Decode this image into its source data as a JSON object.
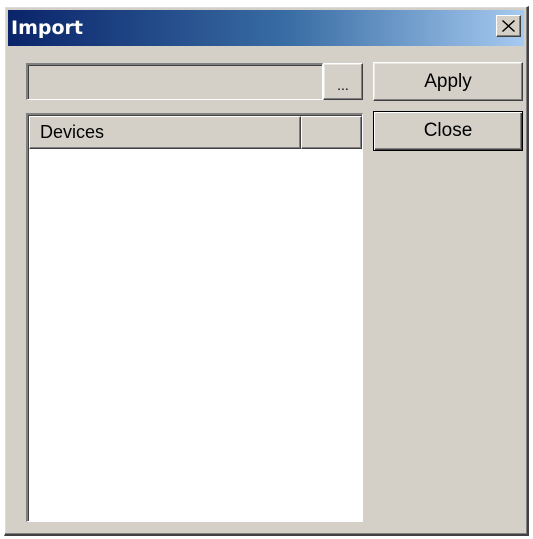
{
  "window": {
    "title": "Import",
    "close_glyph": "✕"
  },
  "path": {
    "value": "",
    "browse_label": "..."
  },
  "buttons": {
    "apply_label": "Apply",
    "close_label": "Close"
  },
  "list": {
    "columns": [
      "Devices",
      ""
    ],
    "rows": []
  },
  "colors": {
    "title_gradient_start": "#0a246a",
    "title_gradient_end": "#a6caf0",
    "face": "#d4d0c8"
  },
  "icons": {
    "close": "close-icon"
  }
}
